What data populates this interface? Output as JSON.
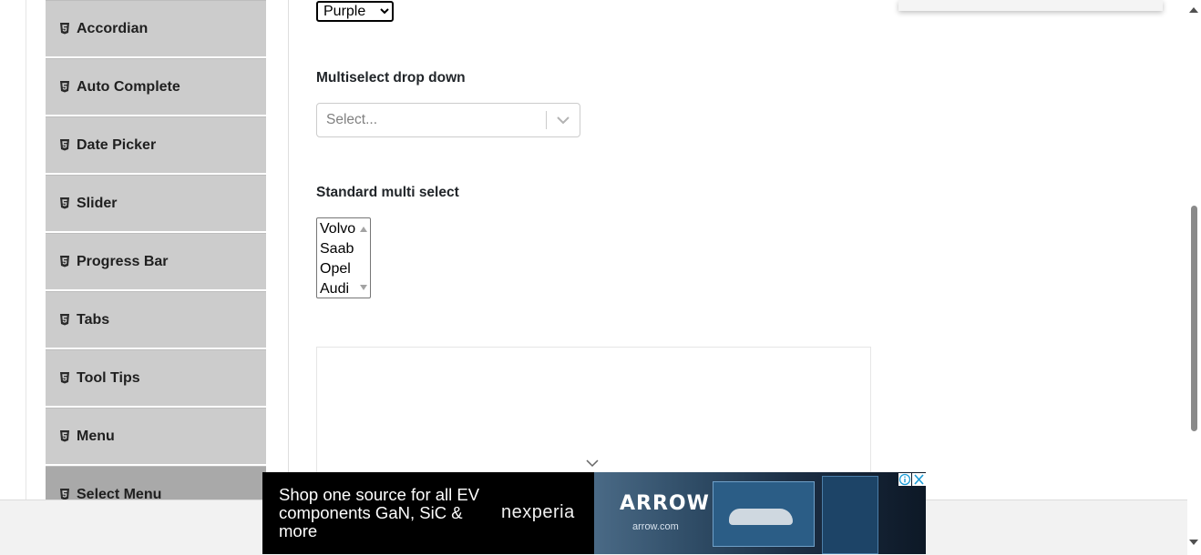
{
  "sidebar": {
    "items": [
      {
        "label": "Accordian",
        "active": false
      },
      {
        "label": "Auto Complete",
        "active": false
      },
      {
        "label": "Date Picker",
        "active": false
      },
      {
        "label": "Slider",
        "active": false
      },
      {
        "label": "Progress Bar",
        "active": false
      },
      {
        "label": "Tabs",
        "active": false
      },
      {
        "label": "Tool Tips",
        "active": false
      },
      {
        "label": "Menu",
        "active": false
      },
      {
        "label": "Select Menu",
        "active": true
      }
    ],
    "item_icon": "html5-icon"
  },
  "old_style_select": {
    "selected": "Purple"
  },
  "multiselect": {
    "label": "Multiselect drop down",
    "placeholder": "Select..."
  },
  "standard_multi": {
    "label": "Standard multi select",
    "options": [
      "Volvo",
      "Saab",
      "Opel",
      "Audi"
    ]
  },
  "bottom_ad": {
    "headline": "Shop one source for all EV components GaN, SiC & more",
    "brand": "nexperia",
    "partner_logo": "ARROW",
    "partner_url": "arrow.com"
  },
  "colors": {
    "sidebar_bg": "#cccccc",
    "sidebar_active_bg": "#a9a9a9",
    "ad_bg": "#000000"
  }
}
